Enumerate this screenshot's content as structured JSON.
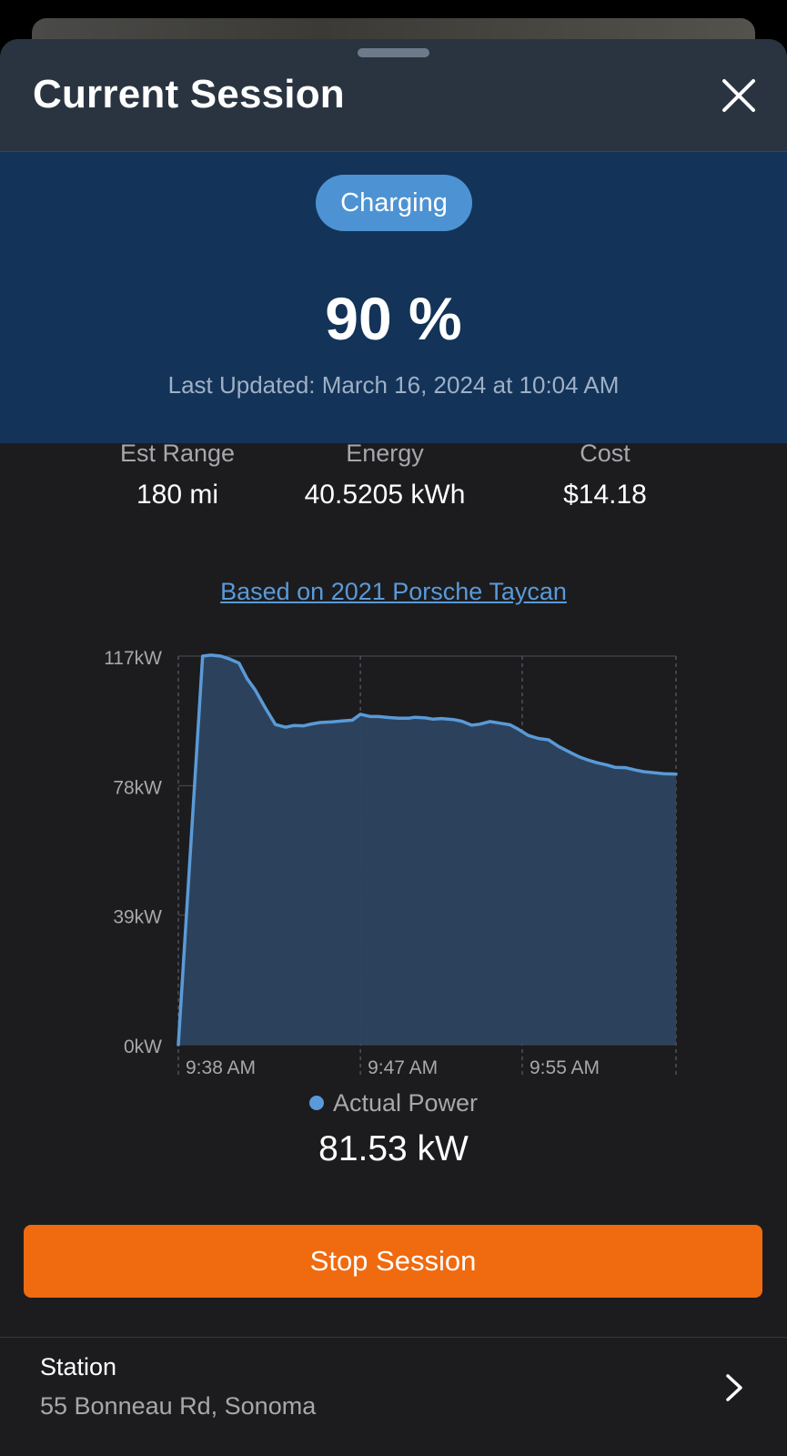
{
  "header": {
    "title": "Current Session"
  },
  "status": {
    "badge": "Charging",
    "percent": "90 %",
    "last_updated": "Last Updated: March 16, 2024 at 10:04 AM"
  },
  "stats": [
    {
      "label": "Est Range",
      "value": "180 mi"
    },
    {
      "label": "Energy",
      "value": "40.5205 kWh"
    },
    {
      "label": "Cost",
      "value": "$14.18"
    }
  ],
  "vehicle_link": "Based on 2021 Porsche Taycan",
  "legend": {
    "series_name": "Actual Power",
    "current_value": "81.53 kW"
  },
  "stop_button": "Stop Session",
  "station": {
    "label": "Station",
    "address": "55 Bonneau Rd, Sonoma"
  },
  "colors": {
    "accent": "#5a9ad8",
    "stop_button": "#f06a0f",
    "status_panel": "#133358",
    "badge": "#4d93d3"
  },
  "icons": {
    "close": "close-icon",
    "chevron": "chevron-right-icon",
    "legend_dot": "legend-dot-icon"
  },
  "chart_data": {
    "type": "area",
    "title": "",
    "xlabel": "",
    "ylabel": "",
    "y_ticks": [
      {
        "value": 117,
        "label": "117kW"
      },
      {
        "value": 78,
        "label": "78kW"
      },
      {
        "value": 39,
        "label": "39kW"
      },
      {
        "value": 0,
        "label": "0kW"
      }
    ],
    "x_ticks": [
      "9:38 AM",
      "9:47 AM",
      "9:55 AM"
    ],
    "x_tick_minutes": [
      0,
      9,
      17
    ],
    "x_axis_start": "9:38 AM",
    "ylim": [
      0,
      117
    ],
    "grid": true,
    "series": [
      {
        "name": "Actual Power",
        "x_minutes": [
          0.0,
          1.2,
          1.6,
          2.1,
          2.5,
          3.0,
          3.4,
          3.8,
          4.3,
          4.8,
          5.3,
          5.7,
          6.2,
          6.6,
          7.0,
          7.6,
          8.1,
          8.6,
          9.0,
          9.5,
          9.9,
          10.4,
          10.9,
          11.4,
          11.7,
          12.2,
          12.6,
          13.0,
          13.6,
          14.0,
          14.5,
          14.9,
          15.4,
          15.9,
          16.4,
          16.8,
          17.3,
          17.8,
          18.3,
          18.8,
          19.3,
          19.8,
          20.3,
          20.7,
          21.2,
          21.6,
          22.1,
          22.6,
          23.0,
          23.5,
          24.0,
          24.6
        ],
        "values": [
          0,
          117,
          117.3,
          117.0,
          116.2,
          114.9,
          110.2,
          106.8,
          101.4,
          96.4,
          95.6,
          96.1,
          96.0,
          96.6,
          97.0,
          97.2,
          97.5,
          97.7,
          99.5,
          98.8,
          98.8,
          98.5,
          98.3,
          98.3,
          98.6,
          98.4,
          98.0,
          98.2,
          97.9,
          97.4,
          96.2,
          96.5,
          97.3,
          96.8,
          96.3,
          95.0,
          93.1,
          92.2,
          91.8,
          89.8,
          88.2,
          86.7,
          85.6,
          84.9,
          84.2,
          83.5,
          83.4,
          82.7,
          82.2,
          81.9,
          81.6,
          81.5
        ]
      }
    ]
  }
}
